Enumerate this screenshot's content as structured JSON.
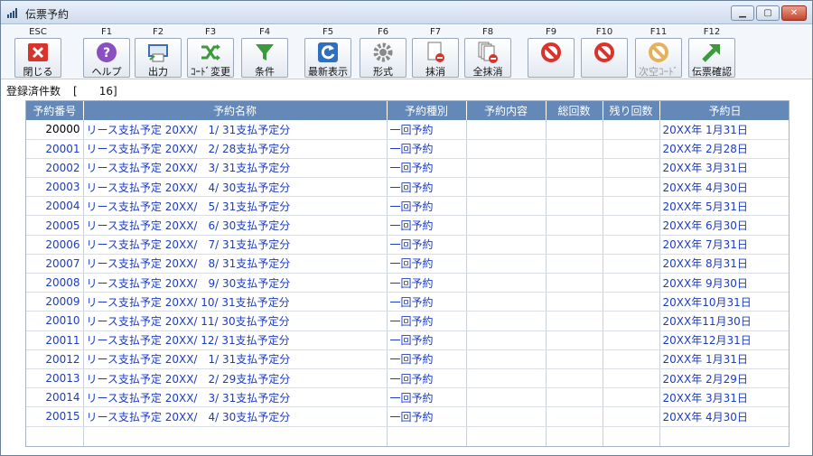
{
  "window": {
    "title": "伝票予約"
  },
  "toolbar": [
    {
      "key": "ESC",
      "label": "閉じる",
      "icon": "close-x-icon",
      "color": "#d9342b",
      "disabled": false
    },
    {
      "key": "F1",
      "label": "ヘルプ",
      "icon": "help-question-icon",
      "color": "#8a4fc2",
      "disabled": false
    },
    {
      "key": "F2",
      "label": "出力",
      "icon": "printer-output-icon",
      "color": "#3a6fb0",
      "disabled": false
    },
    {
      "key": "F3",
      "label": "ｺｰﾄﾞ変更",
      "icon": "shuffle-arrows-icon",
      "color": "#3c9a3c",
      "disabled": false
    },
    {
      "key": "F4",
      "label": "条件",
      "icon": "filter-funnel-icon",
      "color": "#3c9a3c",
      "disabled": false
    },
    {
      "key": "F5",
      "label": "最新表示",
      "icon": "refresh-icon",
      "color": "#2f6fc0",
      "disabled": false
    },
    {
      "key": "F6",
      "label": "形式",
      "icon": "gear-icon",
      "color": "#8a8a8a",
      "disabled": false
    },
    {
      "key": "F7",
      "label": "抹消",
      "icon": "delete-document-icon",
      "color": "#d9342b",
      "disabled": false
    },
    {
      "key": "F8",
      "label": "全抹消",
      "icon": "delete-all-documents-icon",
      "color": "#d9342b",
      "disabled": false
    },
    {
      "key": "F9",
      "label": "",
      "icon": "prohibited-icon",
      "color": "#d9342b",
      "disabled": false
    },
    {
      "key": "F10",
      "label": "",
      "icon": "prohibited-icon",
      "color": "#d9342b",
      "disabled": false
    },
    {
      "key": "F11",
      "label": "次空ｺｰﾄﾞ",
      "icon": "prohibited-icon",
      "color": "#e5b25a",
      "disabled": true
    },
    {
      "key": "F12",
      "label": "伝票確認",
      "icon": "arrow-up-right-icon",
      "color": "#3c9a3c",
      "disabled": false
    }
  ],
  "count": {
    "label": "登録済件数",
    "value": "[　　16]"
  },
  "table": {
    "columns": [
      "予約番号",
      "予約名称",
      "予約種別",
      "予約内容",
      "総回数",
      "残り回数",
      "予約日"
    ],
    "rows": [
      [
        "20000",
        "リース支払予定 20XX/　1/ 31支払予定分",
        "一回予約",
        "",
        "",
        "",
        "20XX年 1月31日"
      ],
      [
        "20001",
        "リース支払予定 20XX/　2/ 28支払予定分",
        "一回予約",
        "",
        "",
        "",
        "20XX年 2月28日"
      ],
      [
        "20002",
        "リース支払予定 20XX/　3/ 31支払予定分",
        "一回予約",
        "",
        "",
        "",
        "20XX年 3月31日"
      ],
      [
        "20003",
        "リース支払予定 20XX/　4/ 30支払予定分",
        "一回予約",
        "",
        "",
        "",
        "20XX年 4月30日"
      ],
      [
        "20004",
        "リース支払予定 20XX/　5/ 31支払予定分",
        "一回予約",
        "",
        "",
        "",
        "20XX年 5月31日"
      ],
      [
        "20005",
        "リース支払予定 20XX/　6/ 30支払予定分",
        "一回予約",
        "",
        "",
        "",
        "20XX年 6月30日"
      ],
      [
        "20006",
        "リース支払予定 20XX/　7/ 31支払予定分",
        "一回予約",
        "",
        "",
        "",
        "20XX年 7月31日"
      ],
      [
        "20007",
        "リース支払予定 20XX/　8/ 31支払予定分",
        "一回予約",
        "",
        "",
        "",
        "20XX年 8月31日"
      ],
      [
        "20008",
        "リース支払予定 20XX/　9/ 30支払予定分",
        "一回予約",
        "",
        "",
        "",
        "20XX年 9月30日"
      ],
      [
        "20009",
        "リース支払予定 20XX/ 10/ 31支払予定分",
        "一回予約",
        "",
        "",
        "",
        "20XX年10月31日"
      ],
      [
        "20010",
        "リース支払予定 20XX/ 11/ 30支払予定分",
        "一回予約",
        "",
        "",
        "",
        "20XX年11月30日"
      ],
      [
        "20011",
        "リース支払予定 20XX/ 12/ 31支払予定分",
        "一回予約",
        "",
        "",
        "",
        "20XX年12月31日"
      ],
      [
        "20012",
        "リース支払予定 20XX/　1/ 31支払予定分",
        "一回予約",
        "",
        "",
        "",
        "20XX年 1月31日"
      ],
      [
        "20013",
        "リース支払予定 20XX/　2/ 29支払予定分",
        "一回予約",
        "",
        "",
        "",
        "20XX年 2月29日"
      ],
      [
        "20014",
        "リース支払予定 20XX/　3/ 31支払予定分",
        "一回予約",
        "",
        "",
        "",
        "20XX年 3月31日"
      ],
      [
        "20015",
        "リース支払予定 20XX/　4/ 30支払予定分",
        "一回予約",
        "",
        "",
        "",
        "20XX年 4月30日"
      ]
    ]
  }
}
